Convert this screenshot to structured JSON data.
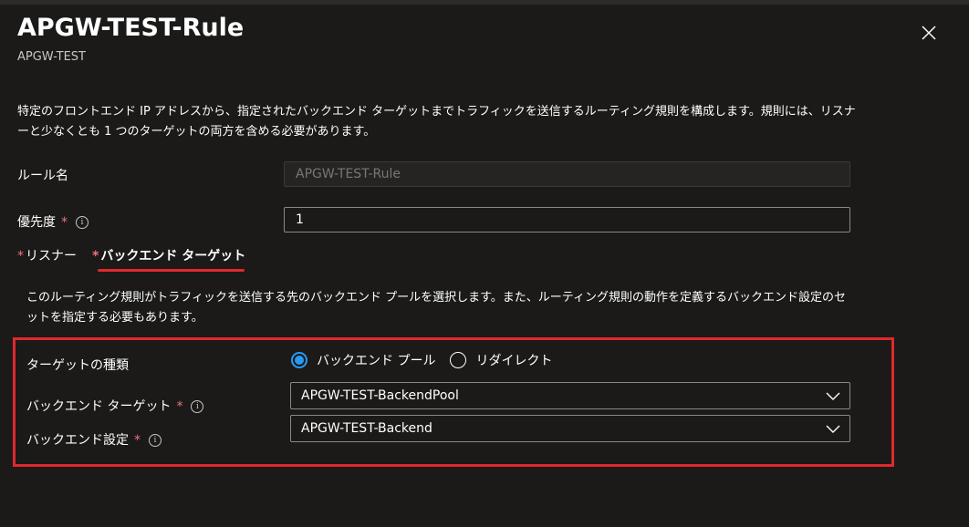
{
  "header": {
    "title": "APGW-TEST-Rule",
    "subtitle": "APGW-TEST"
  },
  "description": "特定のフロントエンド IP アドレスから、指定されたバックエンド ターゲットまでトラフィックを送信するルーティング規則を構成します。規則には、リスナーと少なくとも 1 つのターゲットの両方を含める必要があります。",
  "form": {
    "rule_name_label": "ルール名",
    "rule_name_value": "APGW-TEST-Rule",
    "priority_label": "優先度",
    "priority_value": "1",
    "required_mark": "*",
    "info_glyph": "i"
  },
  "tabs": [
    {
      "label": "リスナー",
      "required": true,
      "active": false
    },
    {
      "label": "バックエンド ターゲット",
      "required": true,
      "active": true
    }
  ],
  "backend": {
    "description": "このルーティング規則がトラフィックを送信する先のバックエンド プールを選択します。また、ルーティング規則の動作を定義するバックエンド設定のセットを指定する必要もあります。",
    "target_type_label": "ターゲットの種類",
    "target_type_options": [
      {
        "label": "バックエンド プール",
        "checked": true
      },
      {
        "label": "リダイレクト",
        "checked": false
      }
    ],
    "backend_target_label": "バックエンド ターゲット",
    "backend_target_value": "APGW-TEST-BackendPool",
    "backend_settings_label": "バックエンド設定",
    "backend_settings_value": "APGW-TEST-Backend"
  },
  "icons": {
    "close": "close-icon",
    "info": "info-icon",
    "chevron": "chevron-down-icon"
  },
  "colors": {
    "background": "#1b1a19",
    "required": "#f1707b",
    "highlight": "#e0282e",
    "radio_accent": "#2899f5"
  }
}
